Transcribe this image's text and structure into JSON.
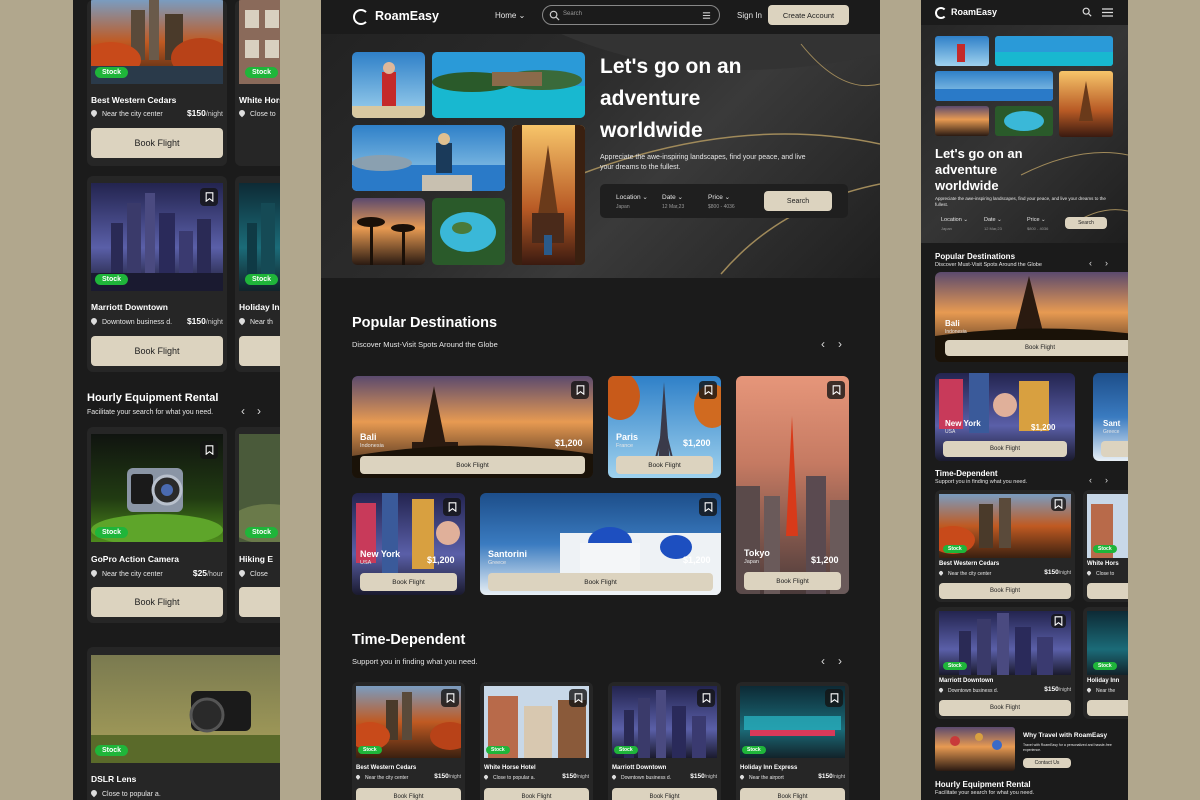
{
  "colors": {
    "accent": "#dcd3bf",
    "stock": "#1fb53a",
    "panel": "#1b1b1b",
    "backdrop": "#b1a78d"
  },
  "left": {
    "hotels": [
      {
        "name": "Best Western Cedars",
        "location": "Near the city center",
        "price": "$150",
        "unit": "/night",
        "stock": "Stock",
        "button": "Book Flight"
      },
      {
        "name": "White Hors",
        "location": "Close to",
        "stock": "Stock"
      },
      {
        "name": "Marriott Downtown",
        "location": "Downtown business d.",
        "price": "$150",
        "unit": "/night",
        "stock": "Stock",
        "button": "Book Flight"
      },
      {
        "name": "Holiday Inn",
        "location": "Near th",
        "stock": "Stock"
      }
    ],
    "section_title": "Hourly Equipment Rental",
    "section_subtitle": "Facilitate your search for what you need.",
    "equipment": [
      {
        "name": "GoPro Action Camera",
        "location": "Near the city center",
        "price": "$25",
        "unit": "/hour",
        "stock": "Stock",
        "button": "Book Flight"
      },
      {
        "name": "Hiking E",
        "location": "Close",
        "stock": "Stock"
      },
      {
        "name": "DSLR Lens",
        "location": "Close to popular a.",
        "stock": "Stock"
      }
    ]
  },
  "center": {
    "brand": "RoamEasy",
    "nav_home": "Home",
    "search_placeholder": "Search",
    "sign_in": "Sign In",
    "create_account": "Create Account",
    "hero_title_1": "Let's go on an",
    "hero_title_2": "adventure",
    "hero_title_3": "worldwide",
    "hero_sub_1": "Appreciate the awe-inspiring landscapes, find your peace, and live",
    "hero_sub_2": "your dreams to the fullest.",
    "filters": [
      {
        "label": "Location",
        "value": "Japan"
      },
      {
        "label": "Date",
        "value": "12 Mar,23"
      },
      {
        "label": "Price",
        "value": "$800 - 4036"
      }
    ],
    "search_button": "Search",
    "popular_title": "Popular Destinations",
    "popular_sub": "Discover Must-Visit Spots Around the Globe",
    "destinations": [
      {
        "name": "Bali",
        "country": "Indonesia",
        "price": "$1,200",
        "button": "Book Flight"
      },
      {
        "name": "Paris",
        "country": "France",
        "price": "$1,200",
        "button": "Book Flight"
      },
      {
        "name": "Tokyo",
        "country": "Japan",
        "price": "$1,200",
        "button": "Book Flight"
      },
      {
        "name": "New York",
        "country": "USA",
        "price": "$1,200",
        "button": "Book Flight"
      },
      {
        "name": "Santorini",
        "country": "Greece",
        "price": "$1,200",
        "button": "Book Flight"
      }
    ],
    "time_title": "Time-Dependent",
    "time_sub": "Support you in finding what you need.",
    "time_cards": [
      {
        "name": "Best Western Cedars",
        "location": "Near the city center",
        "price": "$150",
        "unit": "/night",
        "stock": "Stock",
        "button": "Book Flight"
      },
      {
        "name": "White Horse Hotel",
        "location": "Close to popular a.",
        "price": "$150",
        "unit": "/night",
        "stock": "Stock",
        "button": "Book Flight"
      },
      {
        "name": "Marriott Downtown",
        "location": "Downtown business d.",
        "price": "$150",
        "unit": "/night",
        "stock": "Stock",
        "button": "Book Flight"
      },
      {
        "name": "Holiday Inn Express",
        "location": "Near the airport",
        "price": "$150",
        "unit": "/night",
        "stock": "Stock",
        "button": "Book Flight"
      }
    ]
  },
  "right": {
    "brand": "RoamEasy",
    "hero_title_1": "Let's go on an",
    "hero_title_2": "adventure",
    "hero_title_3": "worldwide",
    "hero_sub": "Appreciate the awe-inspiring landscapes, find your peace, and live your dreams to the fullest.",
    "filters": [
      {
        "label": "Location",
        "value": "Japan"
      },
      {
        "label": "Date",
        "value": "12 Mar,23"
      },
      {
        "label": "Price",
        "value": "$800 - 4036"
      }
    ],
    "search_button": "Search",
    "popular_title": "Popular Destinations",
    "popular_sub": "Discover Must-Visit Spots Around the Globe",
    "bali": {
      "name": "Bali",
      "country": "Indonesia",
      "button": "Book Flight"
    },
    "newyork": {
      "name": "New York",
      "country": "USA",
      "price": "$1,200",
      "button": "Book Flight"
    },
    "santorini": {
      "name": "Sant",
      "country": "Greece"
    },
    "time_title": "Time-Dependent",
    "time_sub": "Support you in finding what you need.",
    "time_cards": [
      {
        "name": "Best Western Cedars",
        "location": "Near the city center",
        "price": "$150",
        "unit": "/night",
        "stock": "Stock",
        "button": "Book Flight"
      },
      {
        "name": "White Hors",
        "location": "Close to",
        "stock": "Stock"
      },
      {
        "name": "Marriott Downtown",
        "location": "Downtown business d.",
        "price": "$150",
        "unit": "/night",
        "stock": "Stock",
        "button": "Book Flight"
      },
      {
        "name": "Holiday Inn",
        "location": "Near the",
        "stock": "Stock"
      }
    ],
    "why_title": "Why Travel with RoamEasy",
    "why_text": "Travel with RoamEasy for a personalized and hassle-free experience.",
    "contact_button": "Contact Us",
    "rental_title": "Hourly Equipment Rental",
    "rental_sub": "Facilitate your search for what you need."
  }
}
